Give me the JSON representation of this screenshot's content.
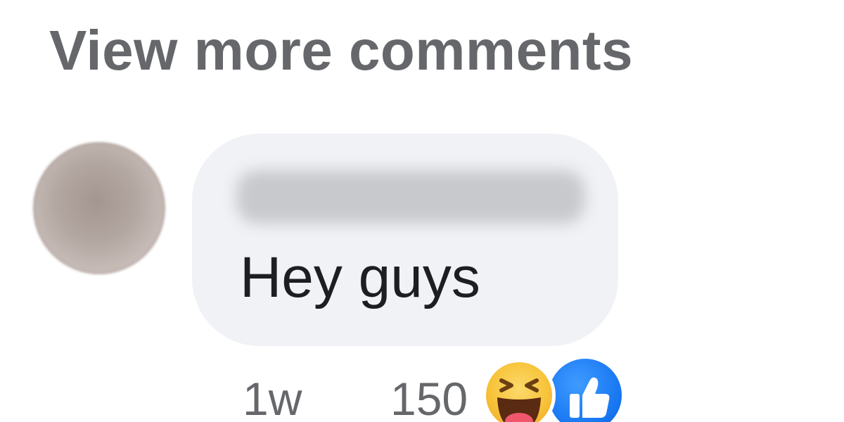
{
  "thread": {
    "view_more_label": "View more comments"
  },
  "comment": {
    "author_name": "",
    "text": "Hey guys",
    "timestamp": "1w",
    "reaction_count": "150",
    "reactions": [
      "haha-icon",
      "like-icon"
    ]
  },
  "colors": {
    "bubble_bg": "#f0f2f5",
    "secondary_text": "#65676b",
    "primary_text": "#1c1e21",
    "like_blue": "#1877f2",
    "haha_yellow": "#f7c33a"
  }
}
